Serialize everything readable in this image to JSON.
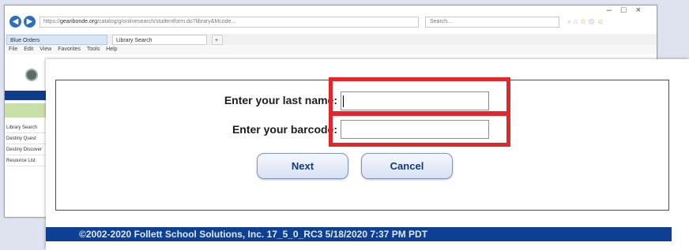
{
  "browser": {
    "address_url": "https://",
    "address_host": "geanbonde.org",
    "address_rest": "/catalog/g/onlinesearch/studentform.do?library&Mcode...",
    "search_placeholder": "Search...",
    "window_controls": [
      "–",
      "□",
      "×"
    ],
    "tabs": [
      {
        "label": "Blue Orders"
      },
      {
        "label": "Library Search"
      }
    ],
    "new_tab_label": "+",
    "menu": [
      "File",
      "Edit",
      "View",
      "Favorites",
      "Tools",
      "Help"
    ],
    "sidebar": {
      "links": [
        "Library Search",
        "Destiny Quest",
        "Destiny Discover",
        "Resource List"
      ]
    }
  },
  "login_form": {
    "last_name_label": "Enter your last name:",
    "last_name_value": "",
    "barcode_label": "Enter your barcode:",
    "barcode_value": "",
    "next_label": "Next",
    "cancel_label": "Cancel"
  },
  "footer": {
    "text": "©2002-2020 Follett School Solutions, Inc.     17_5_0_RC3     5/18/2020 7:37 PM PDT"
  },
  "colors": {
    "highlight": "#e2262c",
    "footer_bg": "#0d3f93",
    "button_text": "#133a78"
  },
  "icons": [
    "back-arrow-icon",
    "forward-arrow-icon",
    "search-icon",
    "home-icon",
    "star-icon",
    "gear-icon",
    "smiley-icon"
  ]
}
